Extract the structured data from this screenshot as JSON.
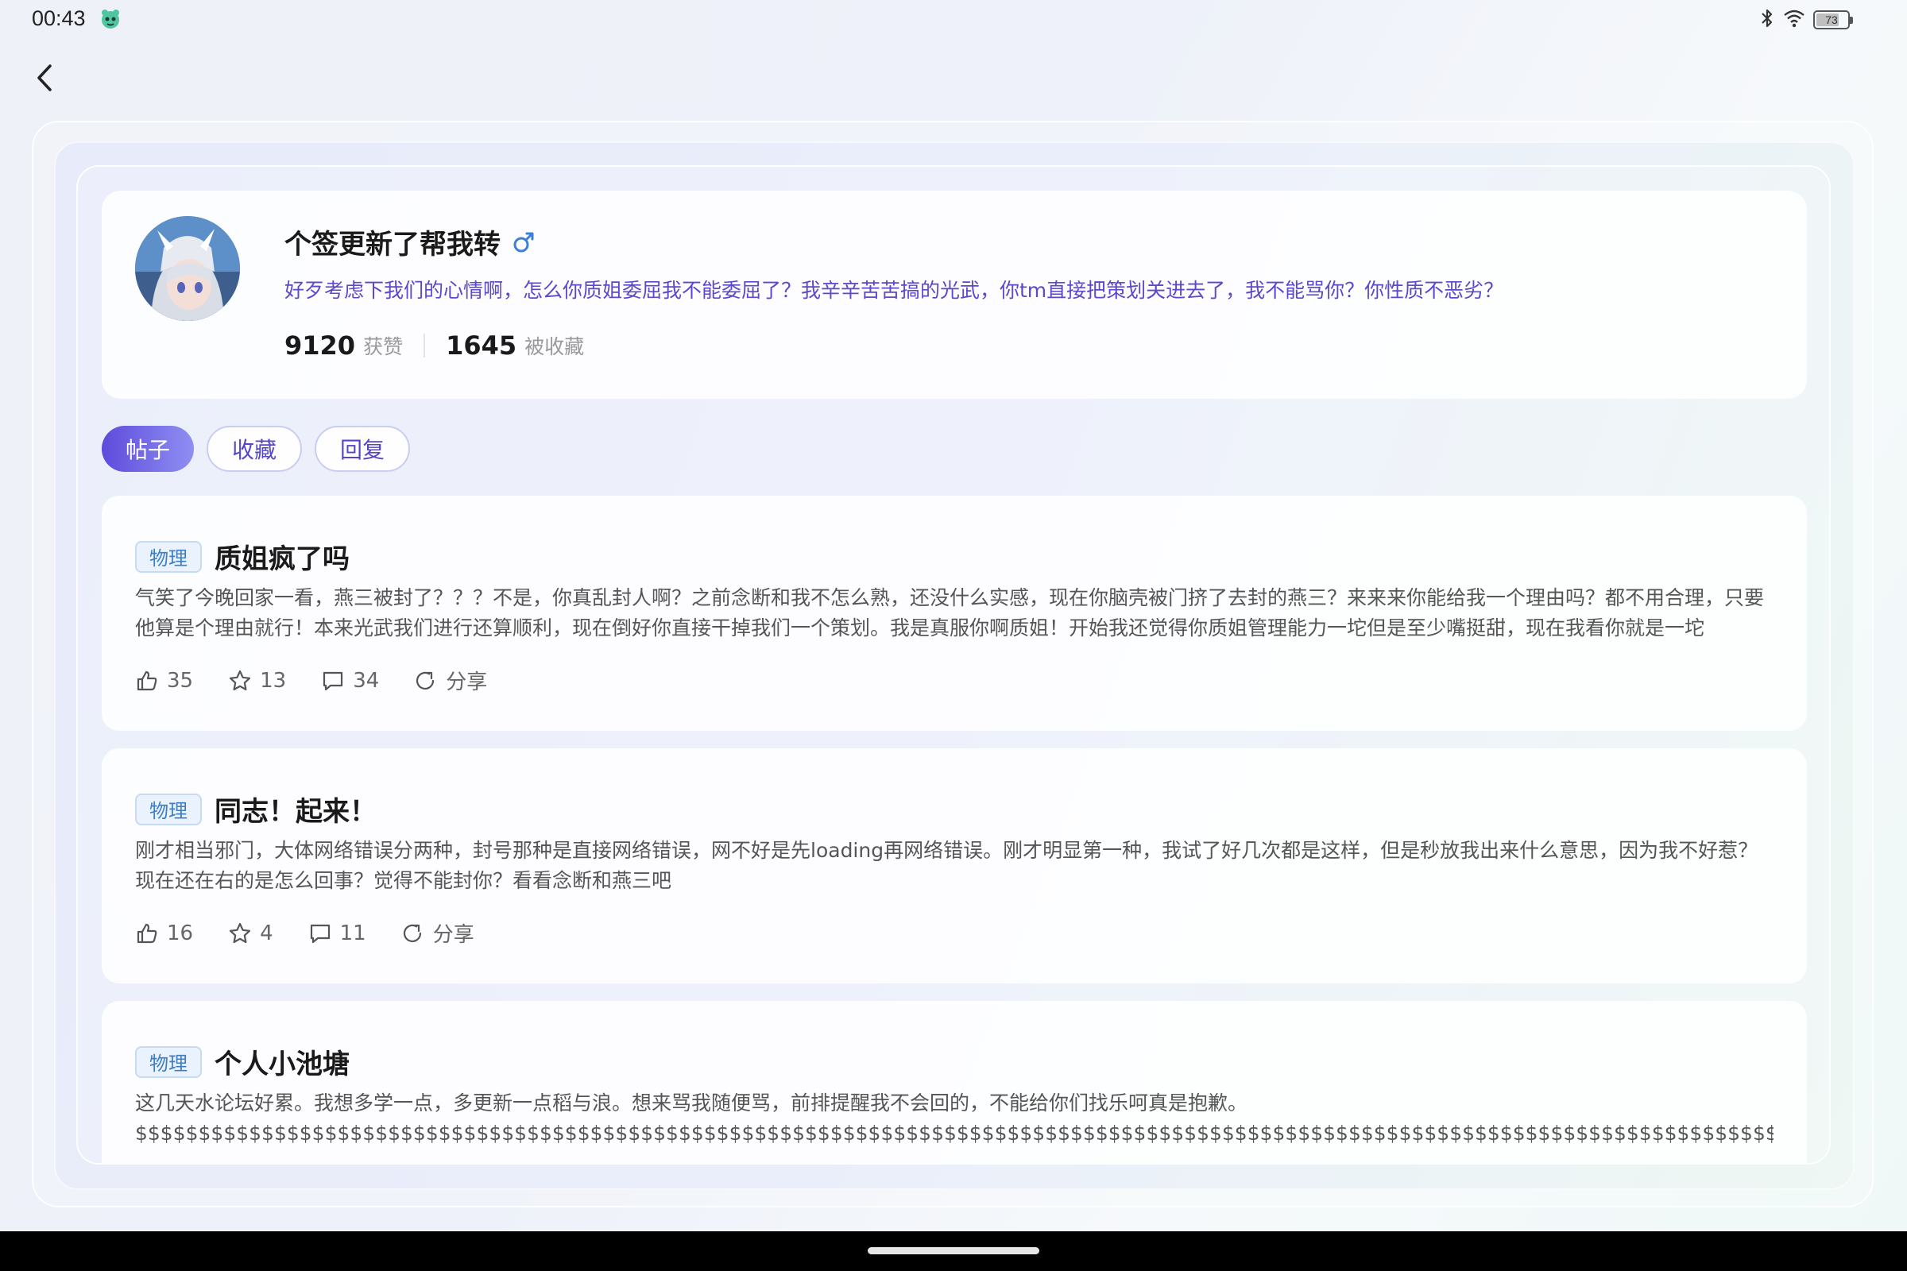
{
  "status_bar": {
    "time": "00:43",
    "battery": "73",
    "battery_level": 0.73
  },
  "profile": {
    "username": "个签更新了帮我转",
    "gender_symbol": "♂",
    "signature": "好歹考虑下我们的心情啊，怎么你质姐委屈我不能委屈了？我辛辛苦苦搞的光武，你tm直接把策划关进去了，我不能骂你？你性质不恶劣？",
    "likes_count": "9120",
    "likes_label": "获赞",
    "favorited_count": "1645",
    "favorited_label": "被收藏"
  },
  "tabs": [
    {
      "label": "帖子",
      "active": true
    },
    {
      "label": "收藏",
      "active": false
    },
    {
      "label": "回复",
      "active": false
    }
  ],
  "posts": [
    {
      "tag": "物理",
      "title": "质姐疯了吗",
      "body": "气笑了今晚回家一看，燕三被封了？？？不是，你真乱封人啊？之前念断和我不怎么熟，还没什么实感，现在你脑壳被门挤了去封的燕三？来来来你能给我一个理由吗？都不用合理，只要他算是个理由就行！本来光武我们进行还算顺利，现在倒好你直接干掉我们一个策划。我是真服你啊质姐！开始我还觉得你质姐管理能力一坨但是至少嘴挺甜，现在我看你就是一坨",
      "likes": "35",
      "stars": "13",
      "comments": "34",
      "share_label": "分享"
    },
    {
      "tag": "物理",
      "title": "同志！起来！",
      "body": "刚才相当邪门，大体网络错误分两种，封号那种是直接网络错误，网不好是先loading再网络错误。刚才明显第一种，我试了好几次都是这样，但是秒放我出来什么意思，因为我不好惹？现在还在右的是怎么回事？觉得不能封你？看看念断和燕三吧",
      "likes": "16",
      "stars": "4",
      "comments": "11",
      "share_label": "分享"
    },
    {
      "tag": "物理",
      "title": "个人小池塘",
      "body": "这几天水论坛好累。我想多学一点，多更新一点稻与浪。想来骂我随便骂，前排提醒我不会回的，不能给你们找乐呵真是抱歉。$$$$$$$$$$$$$$$$$$$$$$$$$$$$$$$$$$$$$$$$$$$$$$$$$$$$$$$$$$$$$$$$$$$$$$$$$$$$$$$$$$$$$$$$$$$$$$$$$$$$$$$$$$$$$$$$$$$$$$$$$$$$$$$$$$$$$$$$$$$$$$$$$$$$$$$$$$$$$$$$$$$$$$$$$$$$$$$$$$$$$$$$$$$$$$$$$$$$$$$$$$$$$$$$$$$$$$$$$"
    }
  ]
}
